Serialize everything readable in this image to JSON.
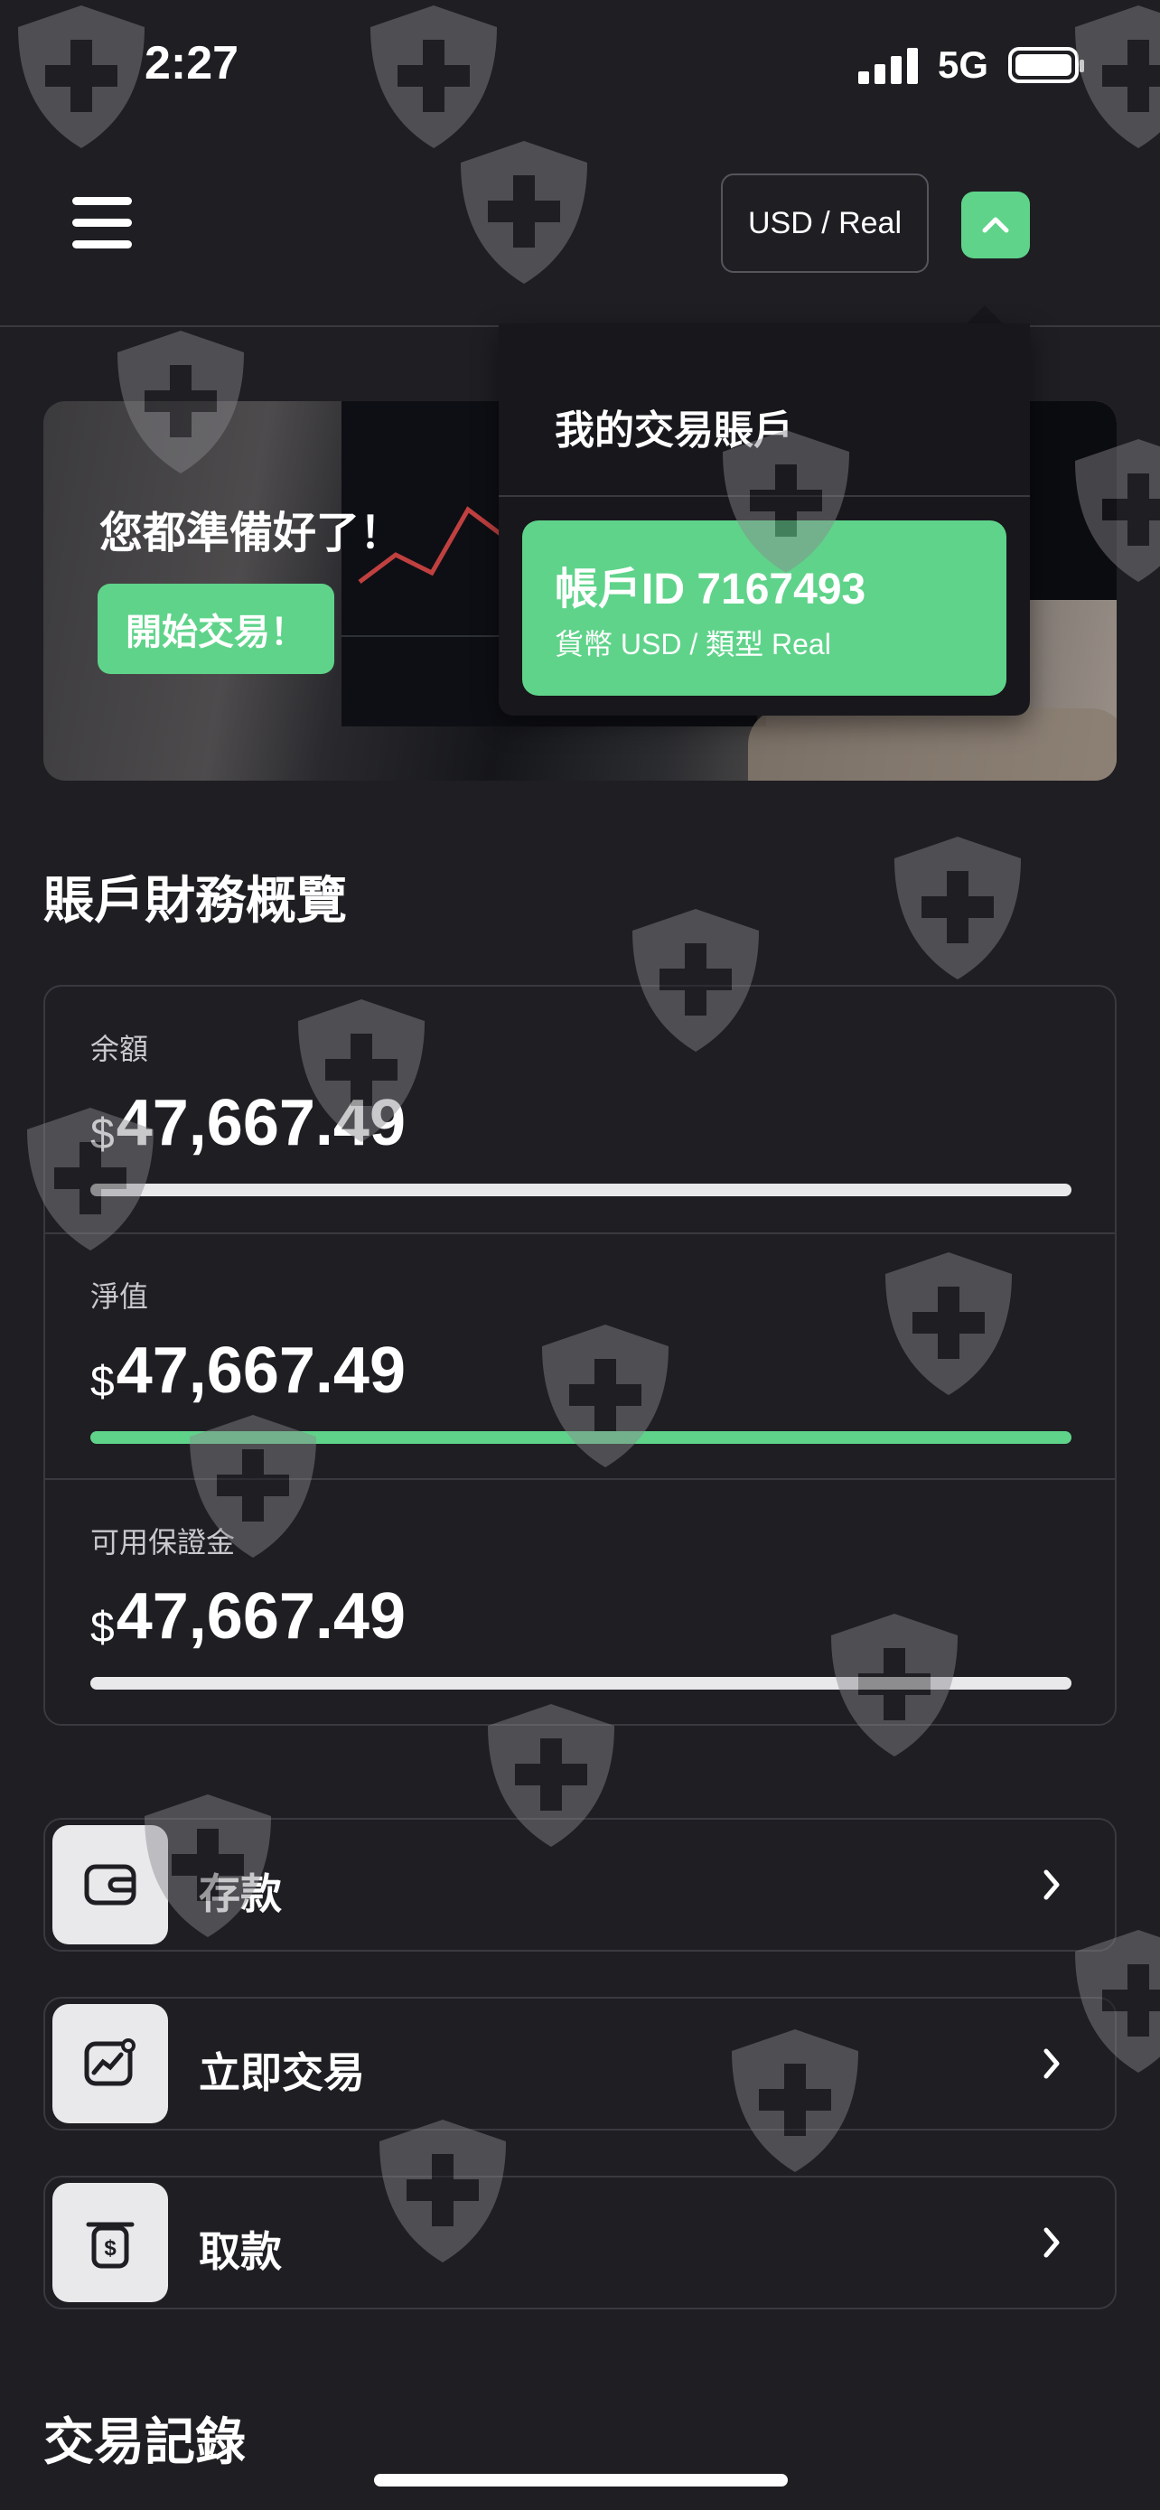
{
  "status": {
    "time": "2:27",
    "network": "5G"
  },
  "header": {
    "account_selector": "USD / Real"
  },
  "banner": {
    "title": "您都準備好了！",
    "button": "開始交易！"
  },
  "dropdown": {
    "title": "我的交易賬戶",
    "account": {
      "id": "帳戶ID 7167493",
      "details": "貨幣 USD / 類型 Real"
    }
  },
  "overview": {
    "title": "賬戶財務概覽",
    "currency_symbol": "$",
    "rows": [
      {
        "label": "余額",
        "amount": "47,667.49",
        "bar_color": "#e9e8ea",
        "fill": 1.0
      },
      {
        "label": "淨值",
        "amount": "47,667.49",
        "bar_color": "#5fd38a",
        "fill": 1.0
      },
      {
        "label": "可用保證金",
        "amount": "47,667.49",
        "bar_color": "#e9e8ea",
        "fill": 1.0
      }
    ]
  },
  "actions": [
    {
      "label": "存款",
      "icon": "wallet-icon"
    },
    {
      "label": "立即交易",
      "icon": "chart-icon"
    },
    {
      "label": "取款",
      "icon": "withdraw-icon"
    }
  ],
  "history": {
    "title": "交易記錄"
  },
  "colors": {
    "accent": "#5fd38a",
    "background": "#1f1e23",
    "border": "#3a393f"
  }
}
